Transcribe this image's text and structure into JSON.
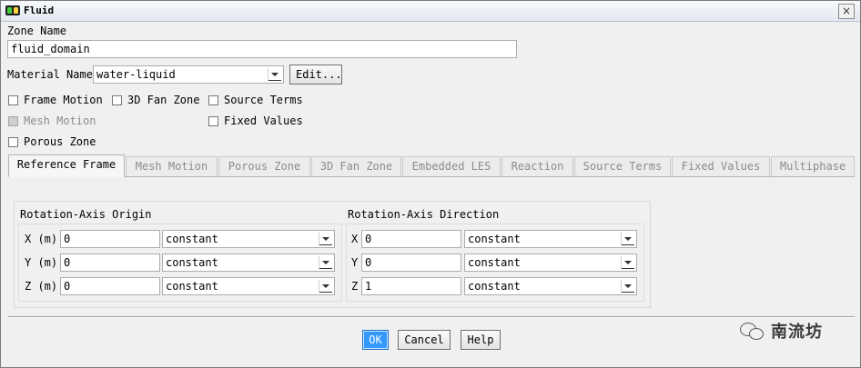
{
  "window": {
    "title": "Fluid",
    "close_glyph": "×"
  },
  "zone": {
    "label": "Zone Name",
    "value": "fluid_domain"
  },
  "material": {
    "label": "Material Name",
    "value": "water-liquid",
    "edit_label": "Edit..."
  },
  "checkboxes": {
    "frame_motion": "Frame Motion",
    "fan_zone": "3D Fan Zone",
    "source_terms": "Source Terms",
    "mesh_motion": "Mesh Motion",
    "fixed_values": "Fixed Values",
    "porous_zone": "Porous Zone"
  },
  "tabs": [
    "Reference Frame",
    "Mesh Motion",
    "Porous Zone",
    "3D Fan Zone",
    "Embedded LES",
    "Reaction",
    "Source Terms",
    "Fixed Values",
    "Multiphase"
  ],
  "origin": {
    "title": "Rotation-Axis Origin",
    "rows": [
      {
        "label": "X (m)",
        "value": "0",
        "method": "constant"
      },
      {
        "label": "Y (m)",
        "value": "0",
        "method": "constant"
      },
      {
        "label": "Z (m)",
        "value": "0",
        "method": "constant"
      }
    ]
  },
  "direction": {
    "title": "Rotation-Axis Direction",
    "rows": [
      {
        "label": "X",
        "value": "0",
        "method": "constant"
      },
      {
        "label": "Y",
        "value": "0",
        "method": "constant"
      },
      {
        "label": "Z",
        "value": "1",
        "method": "constant"
      }
    ]
  },
  "buttons": {
    "ok": "OK",
    "cancel": "Cancel",
    "help": "Help"
  },
  "watermark": {
    "text": "南流坊"
  },
  "icons": {
    "app": "fluent-app-icon",
    "close": "close-icon",
    "dropdown": "chevron-down-icon",
    "watermark": "wechat-icon"
  }
}
